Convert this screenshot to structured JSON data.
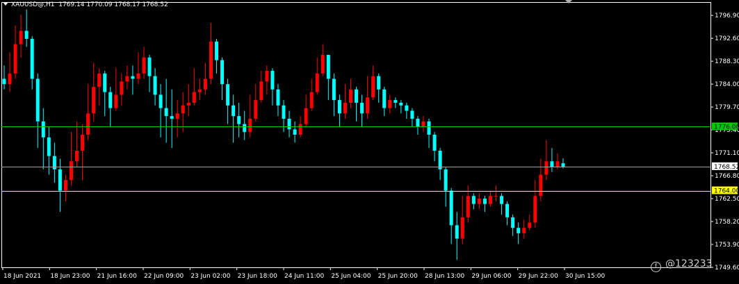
{
  "header": {
    "symbol": "XAUUSD@,H1",
    "ohlc": "1769.14 1770.09 1768.17 1768.52"
  },
  "watermark": "@123233",
  "colors": {
    "background": "#000000",
    "bull": "#ff0000",
    "bear": "#00ffff",
    "grid": "#ffffff",
    "level_green": "#00c800",
    "level_yellow": "#ffff00",
    "price_line": "#a0a0a0"
  },
  "chart_data": {
    "type": "candlestick",
    "symbol": "XAUUSD@",
    "timeframe": "H1",
    "ylim": [
      1749.6,
      1799.4
    ],
    "y_ticks": [
      "1796.90",
      "1792.60",
      "1788.30",
      "1784.00",
      "1779.70",
      "1775.40",
      "1771.10",
      "1766.80",
      "1762.50",
      "1758.20",
      "1753.90",
      "1749.60"
    ],
    "x_ticks": [
      "18 Jun 2021",
      "18 Jun 23:00",
      "21 Jun 16:00",
      "22 Jun 09:00",
      "23 Jun 02:00",
      "23 Jun 18:00",
      "24 Jun 11:00",
      "25 Jun 04:00",
      "25 Jun 20:00",
      "28 Jun 13:00",
      "29 Jun 06:00",
      "29 Jun 22:00",
      "30 Jun 15:00"
    ],
    "levels": [
      {
        "price": 1776.0,
        "label": "1776.00",
        "style": "green"
      },
      {
        "price": 1764.0,
        "label": "1764.00",
        "style": "yellow"
      },
      {
        "price": 1768.52,
        "label": "1768.52",
        "style": "current"
      }
    ],
    "candles": [
      [
        1785.0,
        1784.0,
        1787.5,
        1783.0
      ],
      [
        1784.0,
        1786.0,
        1790.0,
        1782.5
      ],
      [
        1786.0,
        1791.5,
        1795.0,
        1785.0
      ],
      [
        1791.5,
        1794.0,
        1797.0,
        1789.0
      ],
      [
        1794.0,
        1792.5,
        1798.0,
        1791.0
      ],
      [
        1792.5,
        1785.0,
        1793.0,
        1783.0
      ],
      [
        1785.0,
        1777.0,
        1786.0,
        1772.0
      ],
      [
        1777.0,
        1774.0,
        1779.5,
        1768.0
      ],
      [
        1774.0,
        1770.5,
        1776.0,
        1767.0
      ],
      [
        1770.5,
        1768.0,
        1773.0,
        1765.5
      ],
      [
        1768.0,
        1764.0,
        1770.0,
        1760.0
      ],
      [
        1764.0,
        1766.0,
        1767.0,
        1762.0
      ],
      [
        1766.0,
        1769.5,
        1775.0,
        1765.0
      ],
      [
        1769.5,
        1771.5,
        1777.0,
        1768.5
      ],
      [
        1771.5,
        1774.5,
        1776.5,
        1766.0
      ],
      [
        1774.5,
        1778.5,
        1784.0,
        1773.5
      ],
      [
        1778.5,
        1783.5,
        1788.0,
        1777.0
      ],
      [
        1783.5,
        1786.0,
        1787.0,
        1780.0
      ],
      [
        1786.0,
        1782.5,
        1786.5,
        1778.0
      ],
      [
        1782.5,
        1779.5,
        1783.5,
        1776.0
      ],
      [
        1779.5,
        1782.0,
        1787.0,
        1779.0
      ],
      [
        1782.0,
        1784.5,
        1786.0,
        1780.0
      ],
      [
        1784.5,
        1785.5,
        1787.5,
        1783.0
      ],
      [
        1785.5,
        1785.0,
        1787.5,
        1782.0
      ],
      [
        1785.0,
        1786.0,
        1790.0,
        1784.0
      ],
      [
        1786.0,
        1789.0,
        1791.0,
        1785.0
      ],
      [
        1789.0,
        1785.5,
        1789.5,
        1782.5
      ],
      [
        1785.5,
        1782.0,
        1787.0,
        1780.0
      ],
      [
        1782.0,
        1779.5,
        1784.0,
        1774.0
      ],
      [
        1779.5,
        1778.0,
        1785.0,
        1773.0
      ],
      [
        1778.0,
        1777.5,
        1783.0,
        1772.0
      ],
      [
        1777.5,
        1778.5,
        1781.0,
        1774.0
      ],
      [
        1778.5,
        1780.0,
        1782.5,
        1775.0
      ],
      [
        1780.0,
        1780.5,
        1784.0,
        1778.0
      ],
      [
        1780.5,
        1782.5,
        1787.0,
        1780.0
      ],
      [
        1782.5,
        1783.0,
        1785.0,
        1781.0
      ],
      [
        1783.0,
        1785.0,
        1788.0,
        1782.0
      ],
      [
        1785.0,
        1792.0,
        1795.5,
        1784.0
      ],
      [
        1792.0,
        1788.5,
        1792.5,
        1786.0
      ],
      [
        1788.5,
        1784.0,
        1789.0,
        1781.0
      ],
      [
        1784.0,
        1780.0,
        1785.0,
        1776.5
      ],
      [
        1780.0,
        1778.0,
        1782.0,
        1773.0
      ],
      [
        1778.0,
        1776.5,
        1780.5,
        1774.0
      ],
      [
        1776.5,
        1775.0,
        1779.0,
        1773.5
      ],
      [
        1775.0,
        1777.5,
        1782.0,
        1774.0
      ],
      [
        1777.5,
        1781.0,
        1784.0,
        1777.0
      ],
      [
        1781.0,
        1784.5,
        1786.5,
        1780.5
      ],
      [
        1784.5,
        1786.5,
        1787.5,
        1782.0
      ],
      [
        1786.5,
        1783.0,
        1787.0,
        1780.0
      ],
      [
        1783.0,
        1780.0,
        1784.0,
        1778.0
      ],
      [
        1780.0,
        1777.5,
        1781.0,
        1775.0
      ],
      [
        1777.5,
        1775.5,
        1779.0,
        1774.0
      ],
      [
        1775.5,
        1774.5,
        1777.0,
        1773.0
      ],
      [
        1774.5,
        1776.5,
        1778.0,
        1774.0
      ],
      [
        1776.5,
        1779.5,
        1782.0,
        1776.0
      ],
      [
        1779.5,
        1782.5,
        1785.0,
        1779.0
      ],
      [
        1782.5,
        1786.0,
        1789.0,
        1782.0
      ],
      [
        1786.0,
        1789.5,
        1791.5,
        1785.5
      ],
      [
        1789.5,
        1785.0,
        1789.5,
        1781.0
      ],
      [
        1785.0,
        1781.0,
        1786.0,
        1778.0
      ],
      [
        1781.0,
        1778.5,
        1782.0,
        1776.0
      ],
      [
        1778.5,
        1780.5,
        1784.0,
        1777.5
      ],
      [
        1780.5,
        1783.0,
        1785.0,
        1779.5
      ],
      [
        1783.0,
        1780.5,
        1783.5,
        1777.0
      ],
      [
        1780.5,
        1778.5,
        1782.0,
        1776.0
      ],
      [
        1778.5,
        1781.5,
        1785.5,
        1777.5
      ],
      [
        1781.5,
        1785.5,
        1787.5,
        1781.0
      ],
      [
        1785.5,
        1783.0,
        1786.0,
        1780.5
      ],
      [
        1783.0,
        1779.5,
        1783.5,
        1778.0
      ],
      [
        1779.5,
        1781.0,
        1782.0,
        1778.5
      ],
      [
        1781.0,
        1780.5,
        1781.5,
        1779.5
      ],
      [
        1780.5,
        1780.0,
        1781.0,
        1778.5
      ],
      [
        1780.0,
        1779.0,
        1780.5,
        1777.5
      ],
      [
        1779.0,
        1777.5,
        1779.5,
        1776.0
      ],
      [
        1777.5,
        1776.0,
        1778.0,
        1774.5
      ],
      [
        1776.0,
        1777.0,
        1778.0,
        1775.0
      ],
      [
        1777.0,
        1774.5,
        1777.5,
        1772.0
      ],
      [
        1774.5,
        1771.5,
        1775.0,
        1769.5
      ],
      [
        1771.5,
        1768.0,
        1772.0,
        1766.0
      ],
      [
        1768.0,
        1764.0,
        1768.5,
        1761.0
      ],
      [
        1764.0,
        1757.5,
        1764.5,
        1754.0
      ],
      [
        1757.5,
        1755.0,
        1760.0,
        1751.0
      ],
      [
        1755.0,
        1759.0,
        1763.0,
        1754.0
      ],
      [
        1759.0,
        1763.0,
        1765.0,
        1758.0
      ],
      [
        1763.0,
        1761.5,
        1763.5,
        1760.5
      ],
      [
        1761.5,
        1762.5,
        1763.5,
        1760.5
      ],
      [
        1762.5,
        1761.5,
        1763.0,
        1760.0
      ],
      [
        1761.5,
        1763.0,
        1764.0,
        1761.0
      ],
      [
        1763.0,
        1763.0,
        1765.0,
        1762.0
      ],
      [
        1763.0,
        1761.5,
        1763.5,
        1759.5
      ],
      [
        1761.5,
        1759.0,
        1762.0,
        1757.5
      ],
      [
        1759.0,
        1757.0,
        1759.5,
        1755.5
      ],
      [
        1757.0,
        1756.0,
        1758.0,
        1754.0
      ],
      [
        1756.0,
        1757.0,
        1758.5,
        1755.0
      ],
      [
        1757.0,
        1758.0,
        1759.5,
        1756.5
      ],
      [
        1758.0,
        1763.0,
        1766.0,
        1757.0
      ],
      [
        1763.0,
        1767.0,
        1770.0,
        1762.0
      ],
      [
        1767.0,
        1769.5,
        1773.5,
        1766.0
      ],
      [
        1769.5,
        1768.5,
        1772.0,
        1767.5
      ],
      [
        1768.5,
        1769.5,
        1771.0,
        1768.0
      ],
      [
        1769.14,
        1768.52,
        1770.09,
        1768.17
      ]
    ]
  }
}
